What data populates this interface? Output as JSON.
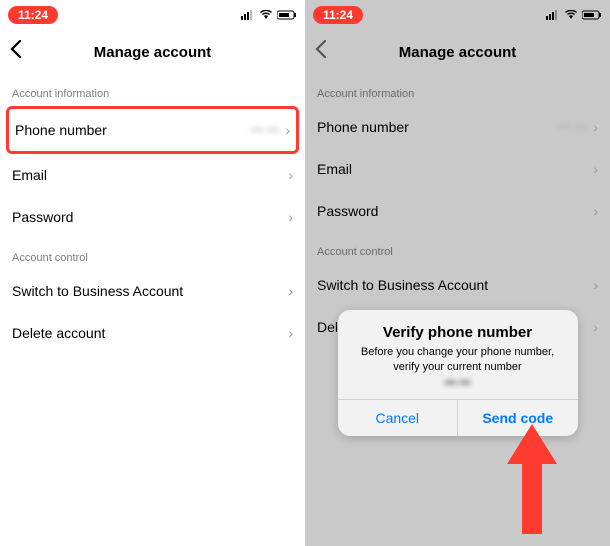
{
  "status": {
    "time": "11:24"
  },
  "nav": {
    "title": "Manage account"
  },
  "sections": {
    "info_header": "Account information",
    "control_header": "Account control"
  },
  "rows": {
    "phone": "Phone number",
    "phone_value": "••• •••",
    "email": "Email",
    "password": "Password",
    "switch": "Switch to Business Account",
    "delete": "Delete account",
    "delete_partial": "Delete a"
  },
  "alert": {
    "title": "Verify phone number",
    "message": "Before you change your phone number, verify your current number",
    "masked_number": "••• •••",
    "cancel": "Cancel",
    "send": "Send code"
  }
}
